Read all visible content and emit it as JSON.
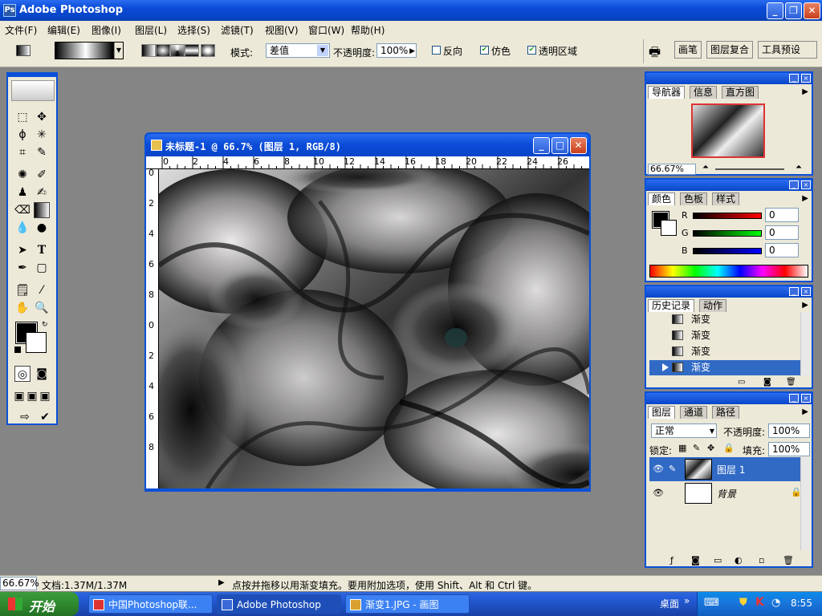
{
  "window": {
    "title": "Adobe Photoshop"
  },
  "menu": [
    "文件(F)",
    "编辑(E)",
    "图像(I)",
    "图层(L)",
    "选择(S)",
    "滤镜(T)",
    "视图(V)",
    "窗口(W)",
    "帮助(H)"
  ],
  "options": {
    "mode_label": "模式:",
    "mode_value": "差值",
    "opacity_label": "不透明度:",
    "opacity_value": "100%",
    "reverse_label": "反向",
    "dither_label": "仿色",
    "transparency_label": "透明区域",
    "reverse_checked": false,
    "dither_checked": true,
    "transparency_checked": true,
    "wells": [
      "画笔",
      "图层复合",
      "工具预设"
    ]
  },
  "document": {
    "title": "未标题-1 @ 66.7% (图层 1, RGB/8)",
    "ruler_h": [
      "0",
      "2",
      "4",
      "6",
      "8",
      "10",
      "12",
      "14",
      "16",
      "18",
      "20",
      "22",
      "24",
      "26"
    ],
    "ruler_v": [
      "0",
      "2",
      "4",
      "6",
      "8",
      "0",
      "2",
      "4",
      "6",
      "8"
    ]
  },
  "navigator": {
    "tabs": [
      "导航器",
      "信息",
      "直方图"
    ],
    "zoom": "66.67%"
  },
  "color": {
    "tabs": [
      "颜色",
      "色板",
      "样式"
    ],
    "r_label": "R",
    "g_label": "G",
    "b_label": "B",
    "r": "0",
    "g": "0",
    "b": "0"
  },
  "history": {
    "tabs": [
      "历史记录",
      "动作"
    ],
    "items": [
      "渐变",
      "渐变",
      "渐变",
      "渐变"
    ],
    "active_index": 3
  },
  "layers": {
    "tabs": [
      "图层",
      "通道",
      "路径"
    ],
    "blend": "正常",
    "opacity_label": "不透明度:",
    "opacity": "100%",
    "lock_label": "锁定:",
    "fill_label": "填充:",
    "fill": "100%",
    "items": [
      "图层 1",
      "背景"
    ]
  },
  "status": {
    "zoom": "66.67%",
    "doc": "文档:1.37M/1.37M",
    "hint": "点按并拖移以用渐变填充。要用附加选项，使用 Shift、Alt 和 Ctrl 键。"
  },
  "taskbar": {
    "start": "开始",
    "tasks": [
      "中国Photoshop联...",
      "Adobe Photoshop",
      "渐变1.JPG - 画图"
    ],
    "active_task": 1,
    "desktop": "桌面",
    "clock": "8:55"
  },
  "colors": {
    "xp_blue": "#0a50d8",
    "panel_bg": "#ece9d8",
    "workspace": "#858585",
    "selection": "#316ac5"
  }
}
